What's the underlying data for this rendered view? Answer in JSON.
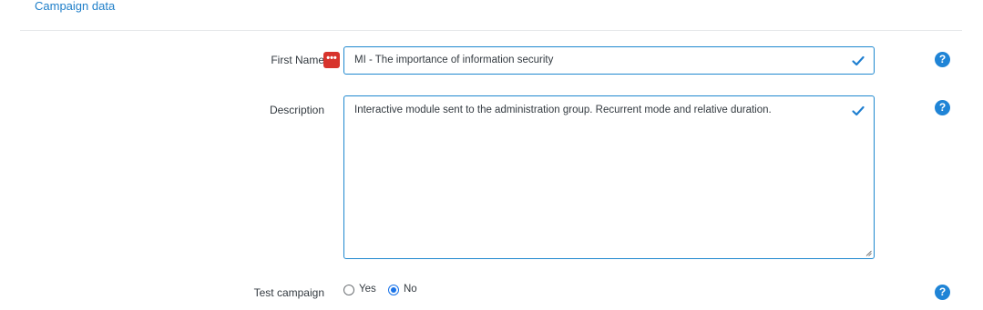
{
  "section": {
    "title": "Campaign data"
  },
  "form": {
    "first_name": {
      "label": "First Name",
      "value": "MI - The importance of information security"
    },
    "description": {
      "label": "Description",
      "value": "Interactive module sent to the administration group. Recurrent mode and relative duration."
    },
    "test_campaign": {
      "label": "Test campaign",
      "options": [
        {
          "label": "Yes",
          "checked": false
        },
        {
          "label": "No",
          "checked": true
        }
      ]
    }
  },
  "help": {
    "glyph": "?"
  },
  "password_manager": {
    "glyph": "•••"
  },
  "colors": {
    "accent": "#1f84d6",
    "field_border": "#1f88cf",
    "password_icon": "#d7332c"
  }
}
